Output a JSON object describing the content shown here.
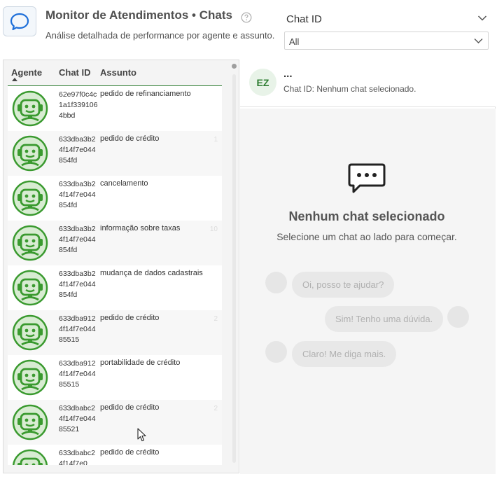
{
  "header": {
    "title": "Monitor de Atendimentos • Chats",
    "subtitle": "Análise detalhada de performance por agente e assunto."
  },
  "filter": {
    "label": "Chat ID",
    "selected": "All"
  },
  "table": {
    "columns": [
      "Agente",
      "Chat ID",
      "Assunto"
    ],
    "rows": [
      {
        "chat_id": "62e97f0c4c1a1f3391064bbd",
        "assunto": "pedido de refinanciamento",
        "faint": ""
      },
      {
        "chat_id": "633dba3b24f14f7e044854fd",
        "assunto": "pedido de crédito",
        "faint": "1"
      },
      {
        "chat_id": "633dba3b24f14f7e044854fd",
        "assunto": "cancelamento",
        "faint": ""
      },
      {
        "chat_id": "633dba3b24f14f7e044854fd",
        "assunto": "informação sobre taxas",
        "faint": "10"
      },
      {
        "chat_id": "633dba3b24f14f7e044854fd",
        "assunto": "mudança de dados cadastrais",
        "faint": ""
      },
      {
        "chat_id": "633dba9124f14f7e04485515",
        "assunto": "pedido de crédito",
        "faint": "2"
      },
      {
        "chat_id": "633dba9124f14f7e04485515",
        "assunto": "portabilidade de crédito",
        "faint": ""
      },
      {
        "chat_id": "633dbabc24f14f7e04485521",
        "assunto": "pedido de crédito",
        "faint": "2"
      },
      {
        "chat_id": "633dbabc24f14f7e0",
        "assunto": "pedido de crédito",
        "faint": ""
      }
    ]
  },
  "chat": {
    "avatar_initials": "EZ",
    "name": "...",
    "subtitle": "Chat ID: Nenhum chat selecionado.",
    "empty_title": "Nenhum chat selecionado",
    "empty_subtitle": "Selecione um chat ao lado para começar.",
    "ghost_messages": [
      "Oi, posso te ajudar?",
      "Sim! Tenho uma dúvida.",
      "Claro! Me diga mais."
    ]
  },
  "colors": {
    "accent_green": "#2e7d32",
    "bot_fill": "#d8ecd2"
  },
  "icons": {
    "app": "chat-bubble-icon",
    "help": "question-circle-icon",
    "agent": "robot-headset-icon",
    "empty_state": "chat-dots-icon"
  }
}
